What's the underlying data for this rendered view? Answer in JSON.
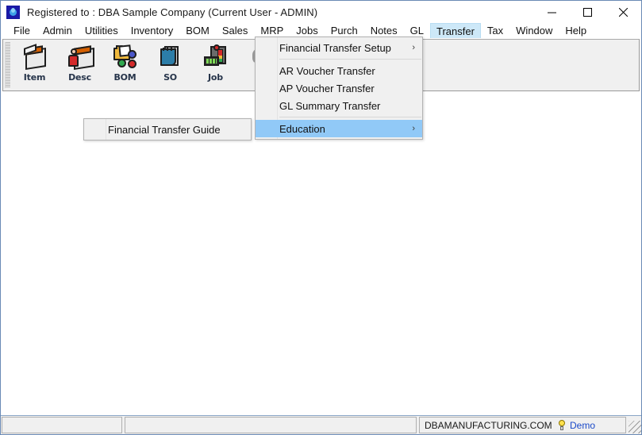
{
  "window": {
    "title": "Registered to : DBA Sample Company (Current User - ADMIN)",
    "app_icon": "app-logo-icon",
    "controls": {
      "minimize": "minimize-icon",
      "maximize": "maximize-icon",
      "close": "close-icon"
    }
  },
  "menubar": {
    "items": [
      {
        "label": "File",
        "active": false
      },
      {
        "label": "Admin",
        "active": false
      },
      {
        "label": "Utilities",
        "active": false
      },
      {
        "label": "Inventory",
        "active": false
      },
      {
        "label": "BOM",
        "active": false
      },
      {
        "label": "Sales",
        "active": false
      },
      {
        "label": "MRP",
        "active": false
      },
      {
        "label": "Jobs",
        "active": false
      },
      {
        "label": "Purch",
        "active": false
      },
      {
        "label": "Notes",
        "active": false
      },
      {
        "label": "GL",
        "active": false
      },
      {
        "label": "Transfer",
        "active": true
      },
      {
        "label": "Tax",
        "active": false
      },
      {
        "label": "Window",
        "active": false
      },
      {
        "label": "Help",
        "active": false
      }
    ]
  },
  "toolbar": {
    "buttons": [
      {
        "label": "Item",
        "icon": "item-box-icon"
      },
      {
        "label": "Desc",
        "icon": "descriptor-person-box-icon"
      },
      {
        "label": "BOM",
        "icon": "bom-folder-icon"
      },
      {
        "label": "SO",
        "icon": "sales-order-notepad-icon"
      },
      {
        "label": "Job",
        "icon": "job-control-panel-icon"
      },
      {
        "label": "",
        "icon": "partially-hidden-icon"
      }
    ]
  },
  "transfer_menu": {
    "items": [
      {
        "label": "Financial Transfer Setup",
        "submenu": true,
        "selected": false,
        "arrow": "›"
      },
      {
        "separator": true
      },
      {
        "label": "AR Voucher Transfer",
        "submenu": false,
        "selected": false
      },
      {
        "label": "AP Voucher Transfer",
        "submenu": false,
        "selected": false
      },
      {
        "label": "GL Summary Transfer",
        "submenu": false,
        "selected": false
      },
      {
        "separator": true
      },
      {
        "label": "Education",
        "submenu": true,
        "selected": true,
        "arrow": "›"
      }
    ],
    "highlight_color": "#91c9f7"
  },
  "education_submenu": {
    "items": [
      {
        "label": "Financial Transfer Guide",
        "selected": false
      }
    ]
  },
  "status_bar": {
    "left_panel": "",
    "middle_panel": "",
    "site": "DBAMANUFACTURING.COM",
    "mode_label": "Demo",
    "mode_icon": "lightbulb-icon",
    "mode_color": "#1a49c8",
    "resize_grip": "resize-grip-icon"
  }
}
